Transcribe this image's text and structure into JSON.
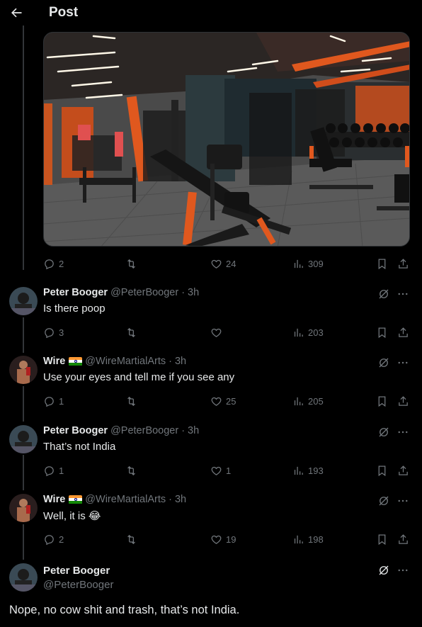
{
  "header": {
    "title": "Post"
  },
  "media": {
    "alt": "Gym interior with orange and black equipment"
  },
  "root_actions": {
    "replies": "2",
    "retweets": "",
    "likes": "24",
    "views": "309"
  },
  "replies": [
    {
      "name": "Peter Booger",
      "flag": false,
      "handle": "@PeterBooger",
      "time": "· 3h",
      "text": "Is there poop",
      "emoji": "",
      "replies": "3",
      "retweets": "",
      "likes": "",
      "views": "203"
    },
    {
      "name": "Wire",
      "flag": true,
      "handle": "@WireMartialArts",
      "time": "· 3h",
      "text": "Use your eyes and tell me if you see any",
      "emoji": "",
      "replies": "1",
      "retweets": "",
      "likes": "25",
      "views": "205"
    },
    {
      "name": "Peter Booger",
      "flag": false,
      "handle": "@PeterBooger",
      "time": "· 3h",
      "text": "That’s not India",
      "emoji": "",
      "replies": "1",
      "retweets": "",
      "likes": "1",
      "views": "193"
    },
    {
      "name": "Wire",
      "flag": true,
      "handle": "@WireMartialArts",
      "time": "· 3h",
      "text": "Well, it is ",
      "emoji": "😂",
      "replies": "2",
      "retweets": "",
      "likes": "19",
      "views": "198"
    }
  ],
  "main_tweet": {
    "name": "Peter Booger",
    "handle": "@PeterBooger",
    "text": "Nope, no cow shit and trash, that’s not India."
  }
}
